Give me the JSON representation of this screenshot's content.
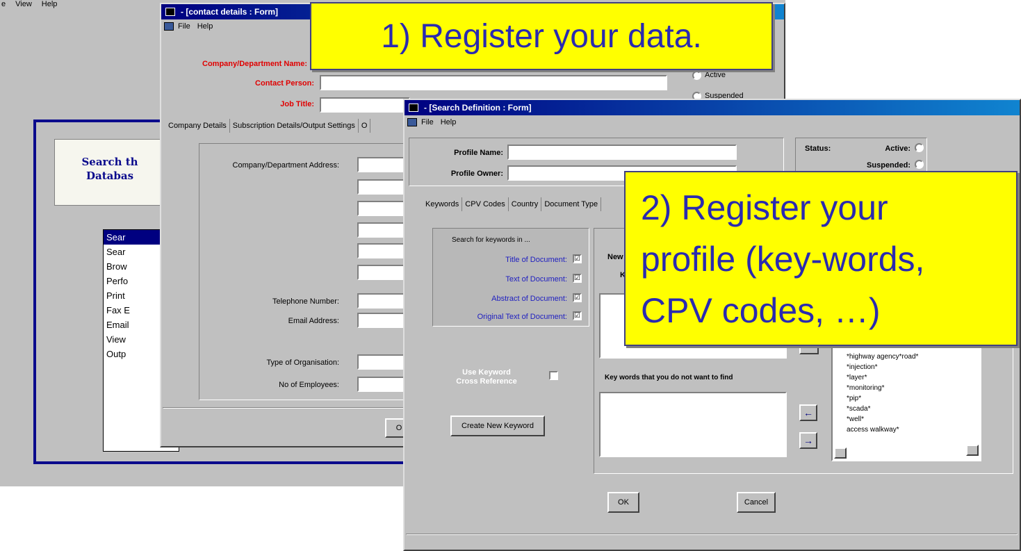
{
  "background_app": {
    "menu": [
      "e",
      "View",
      "Help"
    ],
    "banner": [
      "Search th",
      "Databas"
    ],
    "list_items": [
      "Sear",
      "Sear",
      "Brow",
      "Perfo",
      "Print",
      "Fax E",
      "Email",
      "View",
      "Outp"
    ]
  },
  "contact_window": {
    "title": "- [contact details : Form]",
    "menu": [
      "File",
      "Help"
    ],
    "labels": {
      "company": "Company/Department Name:",
      "contact": "Contact Person:",
      "job": "Job Title:"
    },
    "status_options": [
      "Active",
      "Suspended"
    ],
    "tabs": [
      "Company Details",
      "Subscription Details/Output Settings",
      "O"
    ],
    "address_label": "Company/Department Address:",
    "telephone_label": "Telephone Number:",
    "email_label": "Email Address:",
    "org_type_label": "Type of Organisation:",
    "employees_label": "No of Employees:",
    "bottom_button": "O"
  },
  "search_window": {
    "title": "- [Search Definition : Form]",
    "menu": [
      "File",
      "Help"
    ],
    "profile_name_label": "Profile Name:",
    "profile_owner_label": "Profile Owner:",
    "status_label": "Status:",
    "active_label": "Active:",
    "suspended_label": "Suspended:",
    "tabs": [
      "Keywords",
      "CPV Codes",
      "Country",
      "Document Type"
    ],
    "search_in_title": "Search for keywords in ...",
    "search_in": [
      "Title of Document:",
      "Text of Document:",
      "Abstract of Document:",
      "Original Text of Document:"
    ],
    "search_in_checked": [
      "☑",
      "☑",
      "☑",
      "☑"
    ],
    "partial_labels": [
      "New",
      "K"
    ],
    "cross_ref_label": [
      "Use Keyword",
      "Cross Reference"
    ],
    "create_keyword_button": "Create New Keyword",
    "exclude_label": "Key words that you do not want to find",
    "arrow_left": "←",
    "arrow_right": "→",
    "keyword_list": [
      "*highway agency*road*",
      "*injection*",
      "*layer*",
      "*monitoring*",
      "*pip*",
      "*scada*",
      "*well*",
      "access walkway*"
    ],
    "ok_button": "OK",
    "cancel_button": "Cancel"
  },
  "callouts": {
    "one": "1) Register your data.",
    "two": [
      "2) Register your",
      "profile (key-words,",
      "CPV codes, …)"
    ]
  }
}
